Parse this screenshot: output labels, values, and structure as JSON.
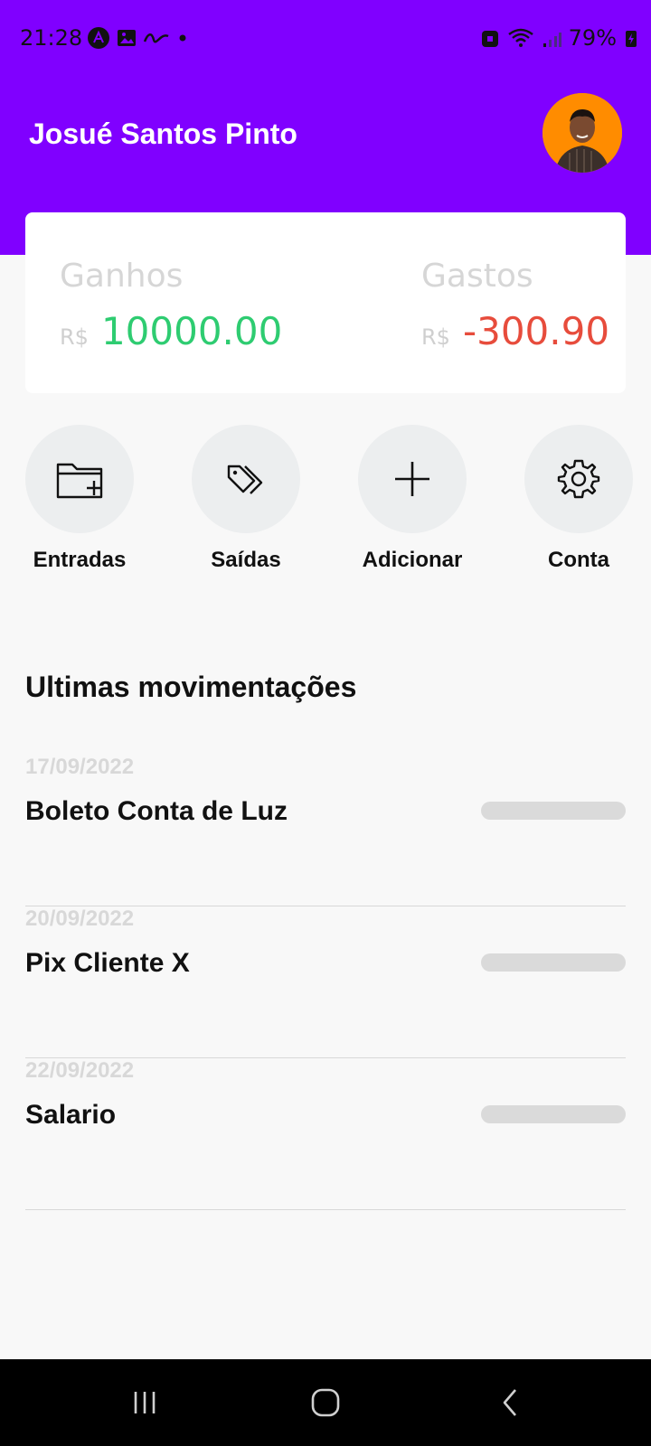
{
  "status_bar": {
    "time": "21:28",
    "battery": "79%"
  },
  "header": {
    "user_name": "Josué Santos Pinto",
    "color": "#8000ff"
  },
  "summary": {
    "earnings": {
      "label": "Ganhos",
      "currency": "R$",
      "amount": "10000.00",
      "color": "#2ecc71"
    },
    "expenses": {
      "label": "Gastos",
      "currency": "R$",
      "amount": "-300.90",
      "color": "#e74c3c"
    }
  },
  "actions": [
    {
      "label": "Entradas",
      "icon": "folder-plus-icon"
    },
    {
      "label": "Saídas",
      "icon": "tags-icon"
    },
    {
      "label": "Adicionar",
      "icon": "plus-icon"
    },
    {
      "label": "Conta",
      "icon": "gear-icon"
    }
  ],
  "section_title": "Ultimas movimentações",
  "transactions": [
    {
      "date": "17/09/2022",
      "title": "Boleto Conta de Luz"
    },
    {
      "date": "20/09/2022",
      "title": "Pix Cliente X"
    },
    {
      "date": "22/09/2022",
      "title": "Salario"
    }
  ]
}
